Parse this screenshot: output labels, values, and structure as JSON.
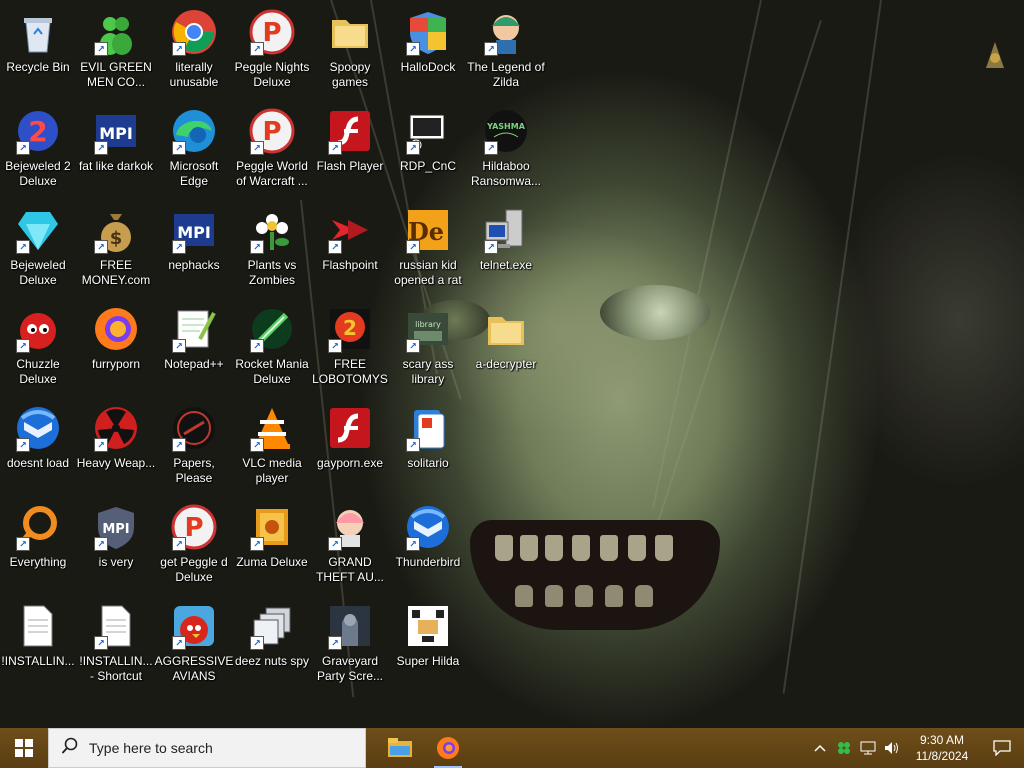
{
  "desktop": {
    "icons": [
      {
        "id": "recycle-bin",
        "label": "Recycle Bin",
        "icon": "recycle-bin-icon",
        "shortcut": false
      },
      {
        "id": "evil-green-men",
        "label": "EVIL GREEN MEN CO...",
        "icon": "green-men-icon",
        "shortcut": true
      },
      {
        "id": "literally-unusable",
        "label": "literally unusable",
        "icon": "chrome-icon",
        "shortcut": true
      },
      {
        "id": "peggle-nights",
        "label": "Peggle Nights Deluxe",
        "icon": "peggle-icon",
        "shortcut": true
      },
      {
        "id": "spoopy-games",
        "label": "Spoopy games",
        "icon": "folder-icon",
        "shortcut": false
      },
      {
        "id": "hallodock",
        "label": "HalloDock",
        "icon": "shield-icon",
        "shortcut": true
      },
      {
        "id": "legend-of-zilda",
        "label": "The Legend of Zilda",
        "icon": "zilda-icon",
        "shortcut": true
      },
      {
        "id": "bejeweled-2",
        "label": "Bejeweled 2 Deluxe",
        "icon": "bejeweled2-icon",
        "shortcut": true
      },
      {
        "id": "fat-like-darkok",
        "label": "fat like darkok",
        "icon": "mpi-icon",
        "shortcut": true
      },
      {
        "id": "microsoft-edge",
        "label": "Microsoft Edge",
        "icon": "edge-icon",
        "shortcut": true
      },
      {
        "id": "peggle-world",
        "label": "Peggle World of Warcraft ...",
        "icon": "peggle-icon",
        "shortcut": true
      },
      {
        "id": "flash-player",
        "label": "Flash Player",
        "icon": "flash-icon",
        "shortcut": true
      },
      {
        "id": "rdp-cnc",
        "label": "RDP_CnC",
        "icon": "rdp-icon",
        "shortcut": true
      },
      {
        "id": "hildaboo",
        "label": "Hildaboo Ransomwa...",
        "icon": "yashma-icon",
        "shortcut": true
      },
      {
        "id": "bejeweled",
        "label": "Bejeweled Deluxe",
        "icon": "diamond-icon",
        "shortcut": true
      },
      {
        "id": "free-money",
        "label": "FREE MONEY.com",
        "icon": "money-bag-icon",
        "shortcut": true
      },
      {
        "id": "nephacks",
        "label": "nephacks",
        "icon": "mpi-icon",
        "shortcut": true
      },
      {
        "id": "plants-vs-zombies",
        "label": "Plants vs Zombies",
        "icon": "flower-icon",
        "shortcut": true
      },
      {
        "id": "flashpoint",
        "label": "Flashpoint",
        "icon": "flashpoint-icon",
        "shortcut": true
      },
      {
        "id": "russian-kid",
        "label": "russian kid opened a rat",
        "icon": "de-icon",
        "shortcut": true
      },
      {
        "id": "telnet",
        "label": "telnet.exe",
        "icon": "computer-icon",
        "shortcut": true
      },
      {
        "id": "chuzzle",
        "label": "Chuzzle Deluxe",
        "icon": "chuzzle-icon",
        "shortcut": true
      },
      {
        "id": "furryporn",
        "label": "furryporn",
        "icon": "firefox-icon",
        "shortcut": false
      },
      {
        "id": "notepadpp",
        "label": "Notepad++",
        "icon": "notepadpp-icon",
        "shortcut": true
      },
      {
        "id": "rocket-mania",
        "label": "Rocket Mania Deluxe",
        "icon": "rocket-icon",
        "shortcut": true
      },
      {
        "id": "free-lobotomys",
        "label": "FREE LOBOTOMYS",
        "icon": "lobotomy-icon",
        "shortcut": true
      },
      {
        "id": "scary-ass-library",
        "label": "scary ass library",
        "icon": "library-icon",
        "shortcut": true
      },
      {
        "id": "a-decrypter",
        "label": "a-decrypter",
        "icon": "folder-icon",
        "shortcut": false
      },
      {
        "id": "doesnt-load",
        "label": "doesnt load",
        "icon": "thunderbird-icon",
        "shortcut": true
      },
      {
        "id": "heavy-weap",
        "label": "Heavy Weap...",
        "icon": "radiation-icon",
        "shortcut": true
      },
      {
        "id": "papers-please",
        "label": "Papers, Please",
        "icon": "papers-icon",
        "shortcut": true
      },
      {
        "id": "vlc",
        "label": "VLC media player",
        "icon": "vlc-icon",
        "shortcut": true
      },
      {
        "id": "gayporn",
        "label": "gayporn.exe",
        "icon": "flash-icon",
        "shortcut": false
      },
      {
        "id": "solitario",
        "label": "solitario",
        "icon": "solitario-icon",
        "shortcut": true
      },
      {
        "id": "everything",
        "label": "Everything",
        "icon": "search-ring-icon",
        "shortcut": true
      },
      {
        "id": "is-very",
        "label": "is very",
        "icon": "mpi-shield-icon",
        "shortcut": true
      },
      {
        "id": "get-peggle",
        "label": "get Peggle d Deluxe",
        "icon": "peggle-icon",
        "shortcut": true
      },
      {
        "id": "zuma",
        "label": "Zuma Deluxe",
        "icon": "zuma-icon",
        "shortcut": true
      },
      {
        "id": "grand-theft",
        "label": "GRAND THEFT AU...",
        "icon": "anime-girl-icon",
        "shortcut": true
      },
      {
        "id": "thunderbird",
        "label": "Thunderbird",
        "icon": "thunderbird-icon",
        "shortcut": true
      },
      {
        "id": "installing-1",
        "label": "!INSTALLIN...",
        "icon": "document-icon",
        "shortcut": false
      },
      {
        "id": "installing-2",
        "label": "!INSTALLIN... - Shortcut",
        "icon": "document-icon",
        "shortcut": true
      },
      {
        "id": "aggressive-avians",
        "label": "AGGRESSIVE AVIANS",
        "icon": "angry-bird-icon",
        "shortcut": true
      },
      {
        "id": "deez-nuts-spy",
        "label": "deez nuts spy",
        "icon": "windows-stack-icon",
        "shortcut": true
      },
      {
        "id": "graveyard-party",
        "label": "Graveyard Party Scre...",
        "icon": "graveyard-icon",
        "shortcut": true
      },
      {
        "id": "super-hilda",
        "label": "Super Hilda",
        "icon": "pixel-dog-icon",
        "shortcut": false
      }
    ]
  },
  "taskbar": {
    "search_placeholder": "Type here to search",
    "apps": [
      {
        "name": "file-explorer-icon"
      },
      {
        "name": "firefox-icon"
      }
    ],
    "clock": {
      "time": "9:30 AM",
      "date": "11/8/2024"
    }
  },
  "colors": {
    "taskbar": "#5a3e12",
    "search_bg": "#f2f2f2",
    "label_text": "#ffffff"
  }
}
